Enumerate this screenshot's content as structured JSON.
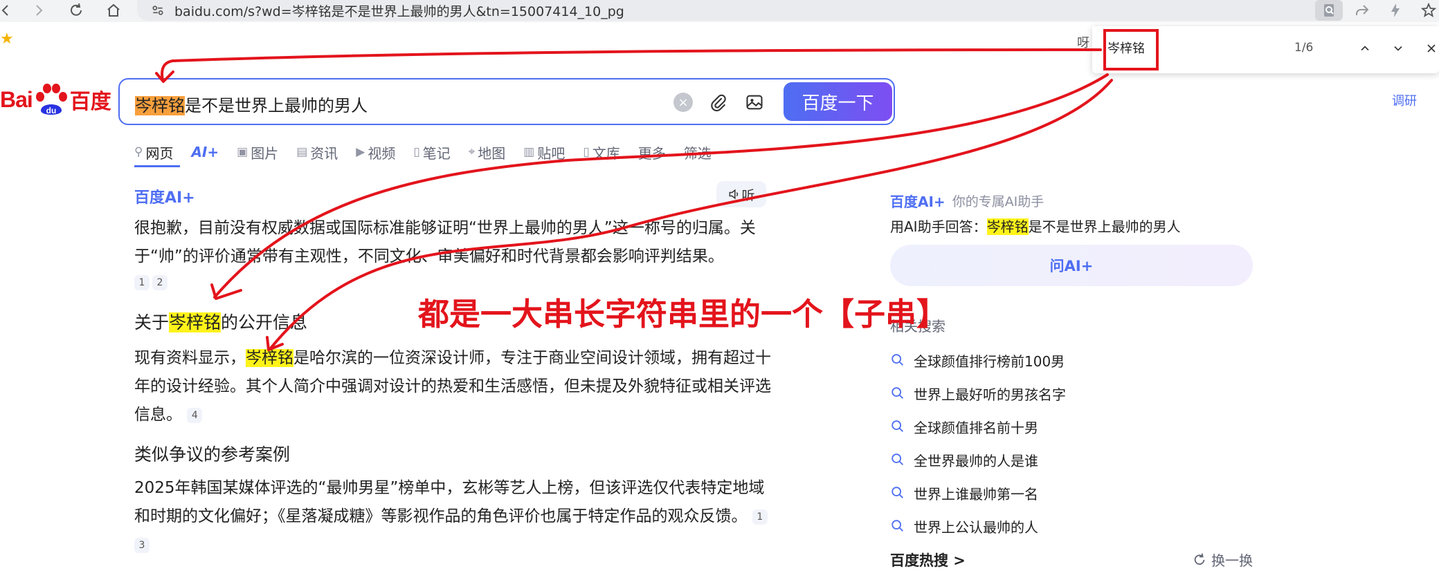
{
  "browser": {
    "url": "baidu.com/s?wd=岑梓铭是不是世界上最帅的男人&tn=15007414_10_pg",
    "star": "★"
  },
  "findbar": {
    "query": "岑梓铭",
    "count": "1/6",
    "peek": "呀"
  },
  "logo": {
    "bai": "Bai",
    "baidu": "百度"
  },
  "search": {
    "highlight": "岑梓铭",
    "rest": "是不是世界上最帅的男人",
    "clear": "×",
    "button": "百度一下"
  },
  "top_right_link": "调研",
  "tabs": [
    {
      "label": "网页",
      "icon": "search-icon"
    },
    {
      "label": "AI+",
      "icon": ""
    },
    {
      "label": "图片",
      "icon": "image-icon"
    },
    {
      "label": "资讯",
      "icon": "news-icon"
    },
    {
      "label": "视频",
      "icon": "video-icon"
    },
    {
      "label": "笔记",
      "icon": "note-icon"
    },
    {
      "label": "地图",
      "icon": "map-icon"
    },
    {
      "label": "贴吧",
      "icon": "tieba-icon"
    },
    {
      "label": "文库",
      "icon": "doc-icon"
    },
    {
      "label": "更多",
      "icon": ""
    },
    {
      "label": "筛选",
      "icon": ""
    }
  ],
  "ai_answer": {
    "brand": "百度AI+",
    "listen": "听",
    "p1": "很抱歉，目前没有权威数据或国际标准能够证明“世界上最帅的男人”这一称号的归属。关于“帅”的评价通常带有主观性，不同文化、审美偏好和时代背景都会影响评判结果。",
    "cites1": [
      "1",
      "2"
    ],
    "h2_pre": "关于",
    "h2_hl": "岑梓铭",
    "h2_post": "的公开信息",
    "p2_pre": "现有资料显示，",
    "p2_hl": "岑梓铭",
    "p2_post": "是哈尔滨的一位资深设计师，专注于商业空间设计领域，拥有超过十年的设计经验。其个人简介中强调对设计的热爱和生活感悟，但未提及外貌特征或相关评选信息。",
    "cite2": "4",
    "h3": "类似争议的参考案例",
    "p3": "2025年韩国某媒体评选的“最帅男星”榜单中，玄彬等艺人上榜，但该评选仅代表特定地域和时期的文化偏好；《星落凝成糖》等影视作品的角色评价也属于特定作品的观众反馈。",
    "cites3": [
      "1",
      "3"
    ]
  },
  "right": {
    "ai_brand": "百度AI+",
    "ai_sub": "你的专属AI助手",
    "question_pre": "用AI助手回答：",
    "question_hl": "岑梓铭",
    "question_post": "是不是世界上最帅的男人",
    "ask_btn": "问AI+",
    "related_title": "相关搜索",
    "related": [
      "全球颜值排行榜前100男",
      "世界上最好听的男孩名字",
      "全球颜值排名前十男",
      "全世界最帅的人是谁",
      "世界上谁最帅第一名",
      "世界上公认最帅的人"
    ],
    "hot_title": "百度热搜 >",
    "refresh": "换一换"
  },
  "annotation": {
    "text": "都是一大串长字符串里的一个【子串】",
    "color": "#e3141c"
  },
  "colors": {
    "accent": "#4e6ef2",
    "brand_red": "#e3141c",
    "highlight_yellow": "#fff31a",
    "highlight_orange": "#f79f3d"
  }
}
